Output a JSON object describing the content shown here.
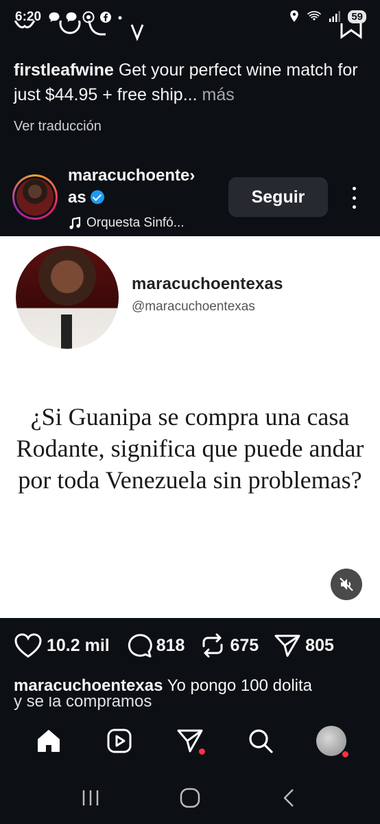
{
  "status_bar": {
    "time": "6:20",
    "battery": "59",
    "left_icons": [
      "chat-bubble-icon",
      "chat-bubble-icon",
      "chrome-icon",
      "facebook-icon",
      "dot-icon"
    ],
    "right_icons": [
      "location-icon",
      "wifi-icon",
      "signal-icon",
      "battery-icon"
    ]
  },
  "previous_post": {
    "username": "firstleafwine",
    "caption": " Get your perfect wine match for just $44.95 + free ship",
    "ellipsis": "...",
    "more": " más",
    "translate": "Ver traducción"
  },
  "post": {
    "username_line1": "maracuchoente›",
    "username_line2": "as",
    "music": "Orquesta Sinfó...",
    "follow_label": "Seguir",
    "media": {
      "display_name": "maracuchoentexas",
      "handle": "@maracuchoentexas",
      "text": "¿Si Guanipa se compra una casa Rodante, significa que puede andar por toda Venezuela sin problemas?"
    },
    "likes": "10.2 mil",
    "comments": "818",
    "reposts": "675",
    "shares": "805",
    "top_comment": {
      "username": "maracuchoentexas",
      "text": " Yo pongo 100 dolita",
      "text_cont": "y se la compramos"
    }
  },
  "colors": {
    "background": "#0c1014",
    "verified": "#1d9bf0",
    "notification_dot": "#ff3040"
  }
}
